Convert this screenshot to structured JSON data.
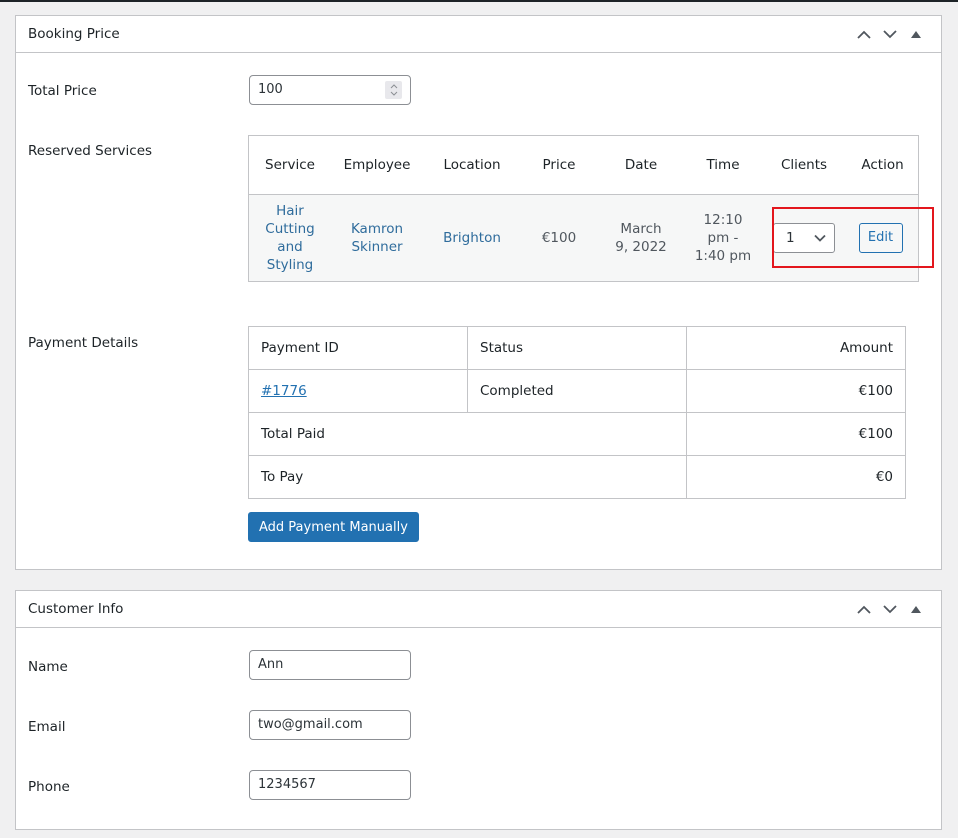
{
  "booking_price": {
    "title": "Booking Price",
    "total_price_label": "Total Price",
    "total_price_value": "100",
    "reserved_services_label": "Reserved Services",
    "services_table": {
      "headers": [
        "Service",
        "Employee",
        "Location",
        "Price",
        "Date",
        "Time",
        "Clients",
        "Action"
      ],
      "rows": [
        {
          "service": "Hair Cutting and Styling",
          "employee": "Kamron Skinner",
          "location": "Brighton",
          "price": "€100",
          "date": "March 9, 2022",
          "time": "12:10 pm - 1:40 pm",
          "clients": "1",
          "action": "Edit"
        }
      ]
    },
    "payment_details_label": "Payment Details",
    "payment_table": {
      "headers": {
        "id": "Payment ID",
        "status": "Status",
        "amount": "Amount"
      },
      "payments": [
        {
          "id": "#1776",
          "status": "Completed",
          "amount": "€100"
        }
      ],
      "total_paid_label": "Total Paid",
      "total_paid_value": "€100",
      "to_pay_label": "To Pay",
      "to_pay_value": "€0"
    },
    "add_payment_button": "Add Payment Manually"
  },
  "customer_info": {
    "title": "Customer Info",
    "name_label": "Name",
    "name_value": "Ann",
    "email_label": "Email",
    "email_value": "two@gmail.com",
    "phone_label": "Phone",
    "phone_value": "1234567"
  },
  "colors": {
    "link": "#2271b1",
    "primary_button": "#2271b1",
    "highlight_box": "#e3161d",
    "background": "#f0f0f1"
  }
}
